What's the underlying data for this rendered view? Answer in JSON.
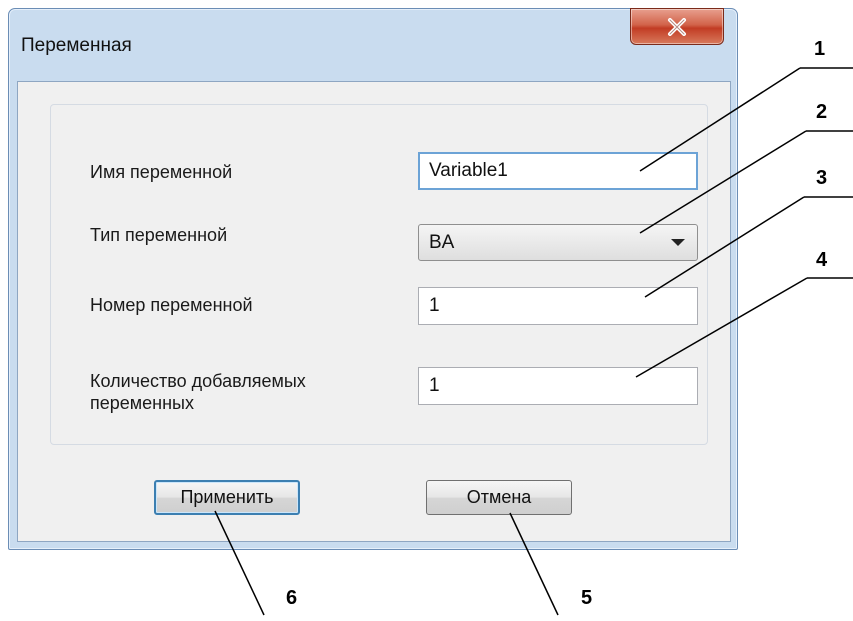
{
  "dialog": {
    "title": "Переменная",
    "close_label": "X"
  },
  "form": {
    "name_label": "Имя переменной",
    "name_value": "Variable1",
    "type_label": "Тип переменной",
    "type_value": "BA",
    "number_label": "Номер переменной",
    "number_value": "1",
    "count_label_line1": "Количество добавляемых",
    "count_label_line2": "переменных",
    "count_value": "1"
  },
  "buttons": {
    "apply_label": "Применить",
    "cancel_label": "Отмена"
  },
  "callouts": [
    "1",
    "2",
    "3",
    "4",
    "5",
    "6"
  ]
}
